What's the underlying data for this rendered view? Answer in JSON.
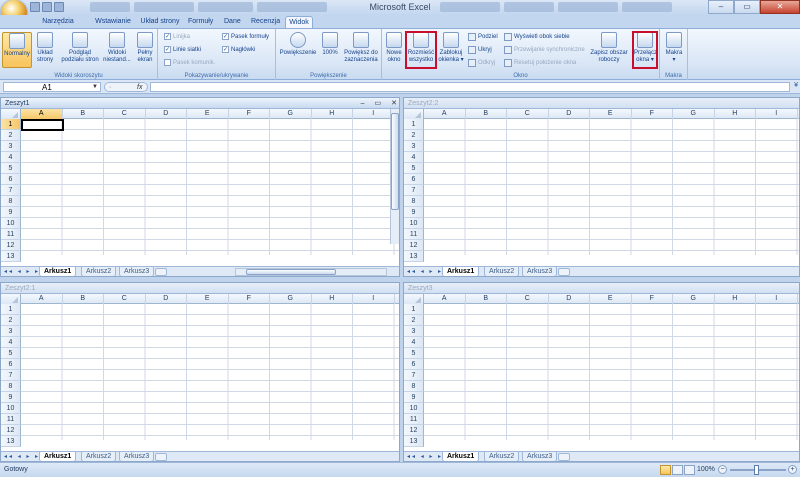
{
  "window": {
    "title": "Microsoft Excel",
    "controls": [
      "–",
      "▭",
      "✕"
    ]
  },
  "tabs": [
    "Narzędzia główne",
    "Wstawianie",
    "Układ strony",
    "Formuły",
    "Dane",
    "Recenzja",
    "Widok"
  ],
  "active_tab": "Widok",
  "ribbon": {
    "widoki": {
      "label": "Widoki skoroszytu",
      "normalny": "Normalny",
      "uklad": [
        "Układ",
        "strony"
      ],
      "podglad": [
        "Podgląd",
        "podziału stron"
      ],
      "niestand": [
        "Widoki",
        "niestand..."
      ],
      "pelny": [
        "Pełny",
        "ekran"
      ]
    },
    "pokazywanie": {
      "label": "Pokazywanie/ukrywanie",
      "linijka": "Linijka",
      "linie": "Linie siatki",
      "komunik": "Pasek komunik.",
      "pasek_formuly": "Pasek formuły",
      "naglowki": "Nagłówki"
    },
    "powiekszenie": {
      "label": "Powiększenie",
      "powiekszenie": "Powiększenie",
      "sto": "100%",
      "do_zazn": [
        "Powiększ do",
        "zaznaczenia"
      ]
    },
    "okno": {
      "label": "Okno",
      "nowe": [
        "Nowe",
        "okno"
      ],
      "rozmiesc": [
        "Rozmieść",
        "wszystko"
      ],
      "zablokuj": [
        "Zablokuj",
        "okienka ▾"
      ],
      "podziel": "Podziel",
      "ukryj": "Ukryj",
      "odkryj": "Odkryj",
      "obok": "Wyświetl obok siebie",
      "synchr": "Przewijanie synchroniczne",
      "resetuj": "Resetuj położenie okna",
      "zapisz": [
        "Zapisz obszar",
        "roboczy"
      ],
      "przelacz": [
        "Przełącz",
        "okna ▾"
      ]
    },
    "makra": {
      "label": "Makra",
      "btn": [
        "Makra",
        "▾"
      ]
    }
  },
  "formula_bar": {
    "cell_ref": "A1",
    "fx": "fx",
    "value": ""
  },
  "columns": [
    "A",
    "B",
    "C",
    "D",
    "E",
    "F",
    "G",
    "H",
    "I"
  ],
  "rows": [
    "1",
    "2",
    "3",
    "4",
    "5",
    "6",
    "7",
    "8",
    "9",
    "10",
    "11",
    "12",
    "13"
  ],
  "panes": [
    {
      "title": "Zeszyt1",
      "sheets": [
        "Arkusz1",
        "Arkusz2",
        "Arkusz3"
      ]
    },
    {
      "title": "Zeszyt2:2",
      "sheets": [
        "Arkusz1",
        "Arkusz2",
        "Arkusz3"
      ]
    },
    {
      "title": "Zeszyt2:1",
      "sheets": [
        "Arkusz1",
        "Arkusz2",
        "Arkusz3"
      ]
    },
    {
      "title": "Zeszyt3",
      "sheets": [
        "Arkusz1",
        "Arkusz2",
        "Arkusz3"
      ]
    }
  ],
  "sheet_nav": "◂◂ ◂ ▸ ▸▸",
  "status": {
    "text": "Gotowy",
    "zoom": "100%",
    "minus": "−",
    "plus": "+"
  }
}
